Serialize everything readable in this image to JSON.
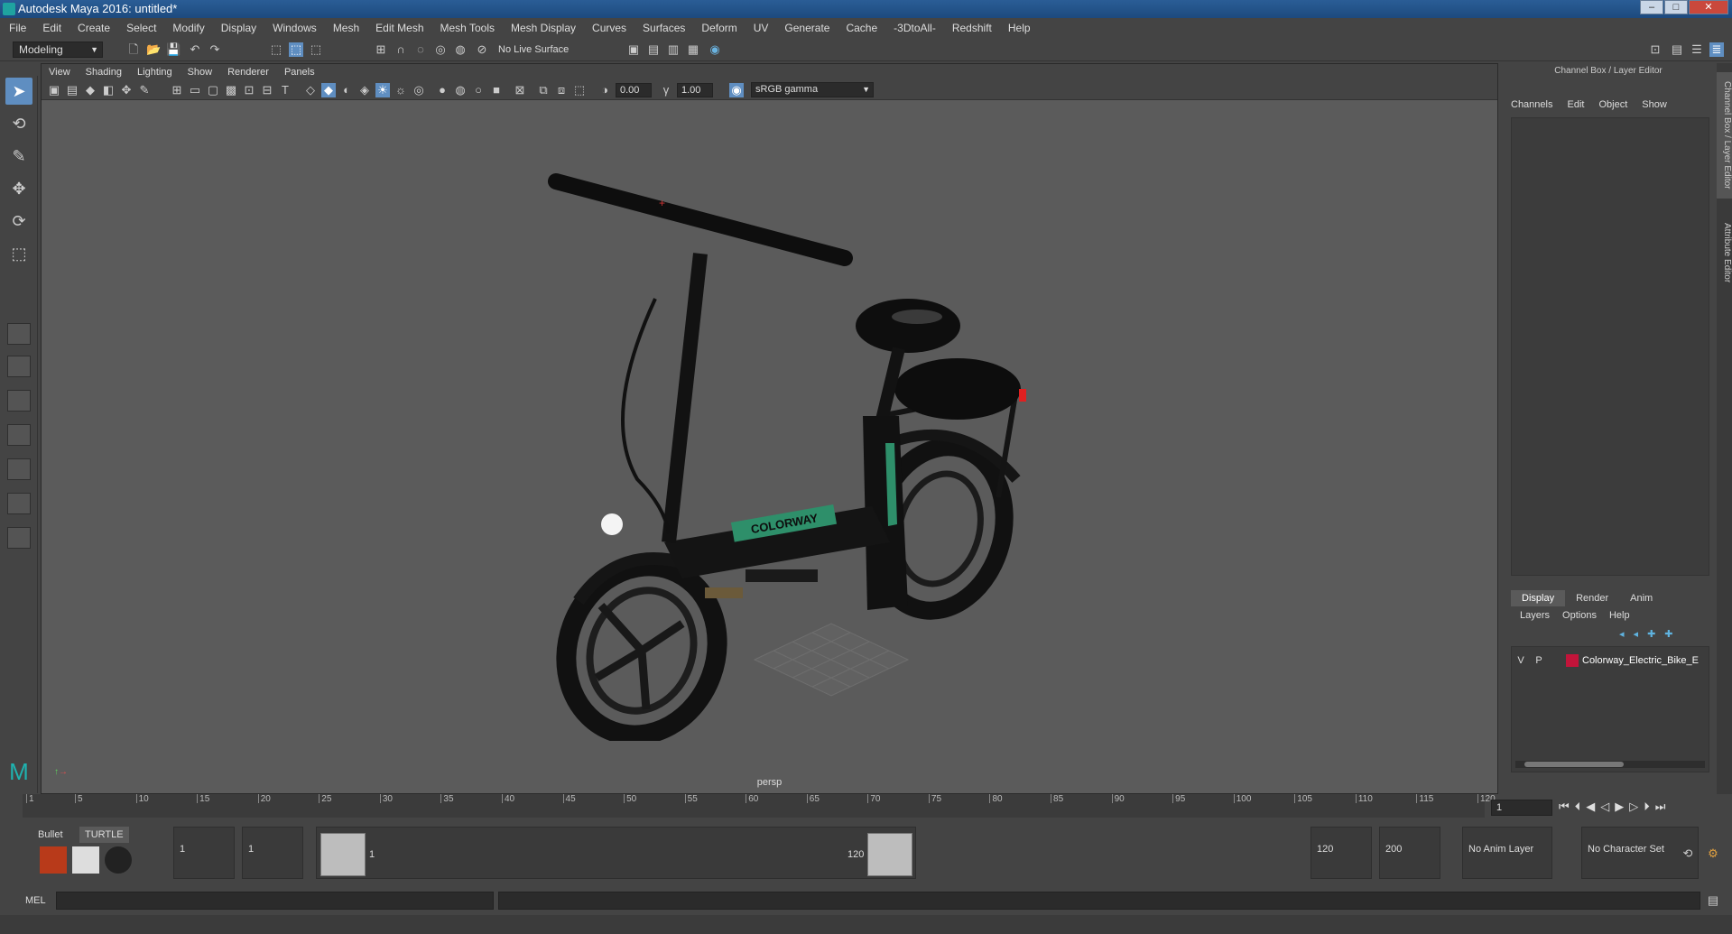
{
  "window": {
    "title": "Autodesk Maya 2016: untitled*"
  },
  "menu": [
    "File",
    "Edit",
    "Create",
    "Select",
    "Modify",
    "Display",
    "Windows",
    "Mesh",
    "Edit Mesh",
    "Mesh Tools",
    "Mesh Display",
    "Curves",
    "Surfaces",
    "Deform",
    "UV",
    "Generate",
    "Cache",
    "-3DtoAll-",
    "Redshift",
    "Help"
  ],
  "toolbar": {
    "mode": "Modeling",
    "live_surface": "No Live Surface"
  },
  "viewport": {
    "menu": [
      "View",
      "Shading",
      "Lighting",
      "Show",
      "Renderer",
      "Panels"
    ],
    "exposure": "0.00",
    "gamma": "1.00",
    "color_space": "sRGB gamma",
    "camera_label": "persp",
    "model_text": "COLORWAY"
  },
  "channel_box": {
    "header": "Channel Box / Layer Editor",
    "tabs": [
      "Channels",
      "Edit",
      "Object",
      "Show"
    ]
  },
  "layer_editor": {
    "tabs": [
      "Display",
      "Render",
      "Anim"
    ],
    "active_tab": "Display",
    "menu": [
      "Layers",
      "Options",
      "Help"
    ],
    "layer": {
      "v": "V",
      "p": "P",
      "name": "Colorway_Electric_Bike_E",
      "color": "#c2143a"
    }
  },
  "side_tabs": [
    "Channel Box / Layer Editor",
    "Attribute Editor"
  ],
  "timeline": {
    "labels": [
      "1",
      "5",
      "10",
      "15",
      "20",
      "25",
      "30",
      "35",
      "40",
      "45",
      "50",
      "55",
      "60",
      "65",
      "70",
      "75",
      "80",
      "85",
      "90",
      "95",
      "100",
      "105",
      "110",
      "115",
      "120"
    ],
    "current_frame": "1"
  },
  "range": {
    "shelf_tabs": [
      "Bullet",
      "TURTLE"
    ],
    "start": "1",
    "start_inner": "1",
    "slider_start": "1",
    "slider_end": "120",
    "end_inner": "120",
    "end": "200",
    "anim_layer": "No Anim Layer",
    "character_set": "No Character Set"
  },
  "command": {
    "label": "MEL"
  }
}
